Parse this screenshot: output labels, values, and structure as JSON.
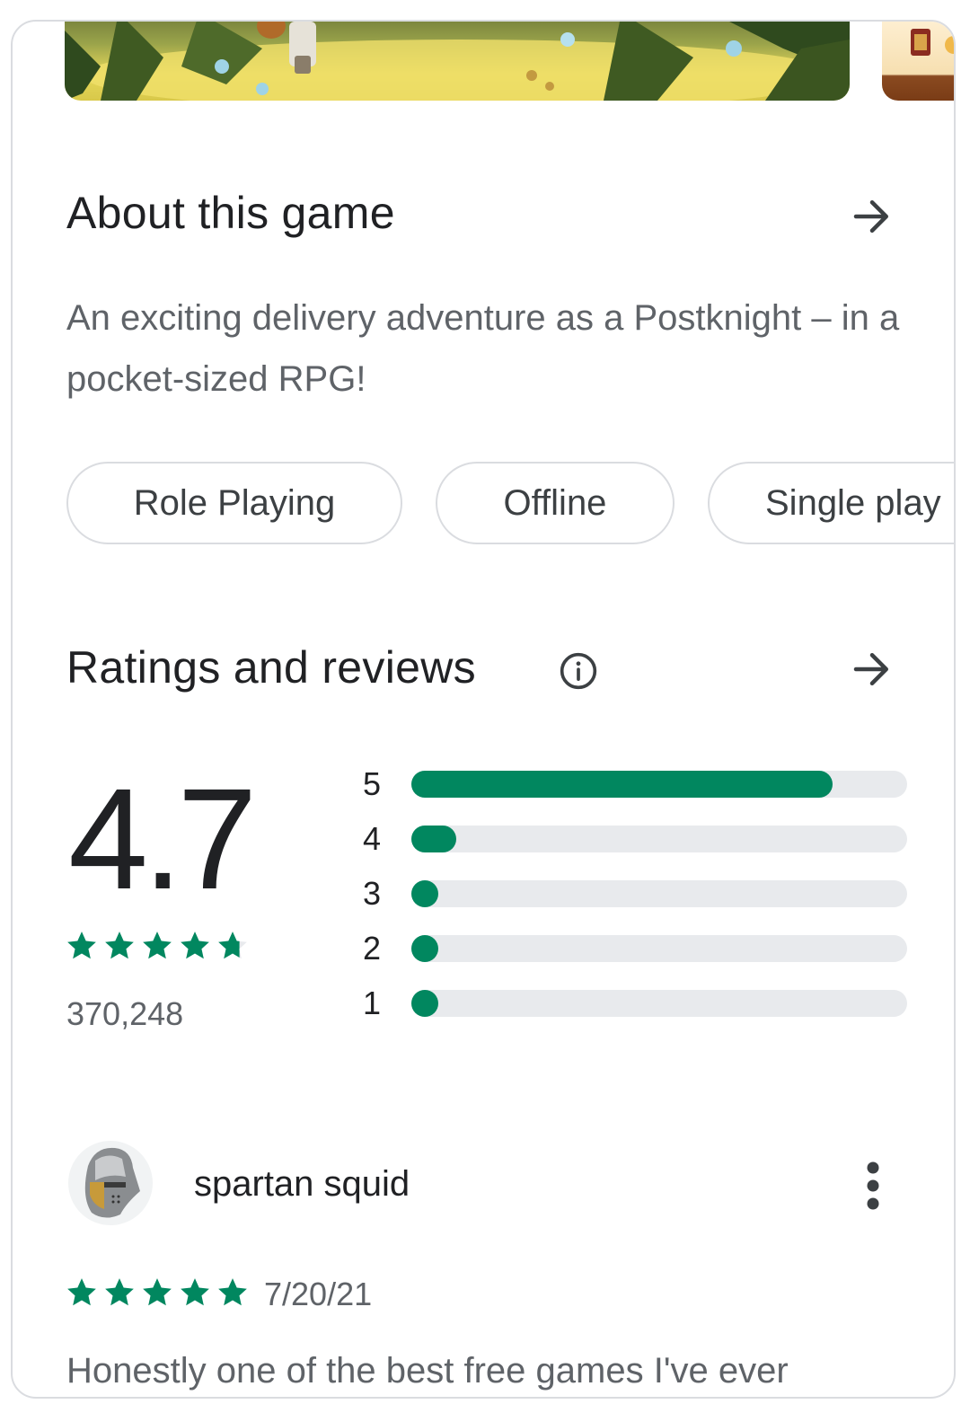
{
  "about": {
    "title": "About this game",
    "description": "An exciting delivery adventure as a Postknight – in a pocket-sized RPG!",
    "tags": [
      "Role Playing",
      "Offline",
      "Single play"
    ]
  },
  "ratings": {
    "title": "Ratings and reviews",
    "average": "4.7",
    "count": "370,248",
    "stars_value": 4.7,
    "distribution": [
      {
        "label": "5",
        "fraction": 0.85
      },
      {
        "label": "4",
        "fraction": 0.09
      },
      {
        "label": "3",
        "fraction": 0.01
      },
      {
        "label": "2",
        "fraction": 0.01
      },
      {
        "label": "1",
        "fraction": 0.01
      }
    ]
  },
  "review": {
    "author": "spartan squid",
    "rating": 5,
    "date": "7/20/21",
    "text": "Honestly one of the best free games I've ever"
  },
  "colors": {
    "accent": "#01875f",
    "track": "#e8eaed",
    "text_primary": "#202124",
    "text_secondary": "#5f6368",
    "border": "#dadce0"
  },
  "icons": {
    "about_arrow": "arrow-right-icon",
    "ratings_arrow": "arrow-right-icon",
    "info": "info-icon",
    "more": "more-vert-icon",
    "star": "star-icon"
  }
}
